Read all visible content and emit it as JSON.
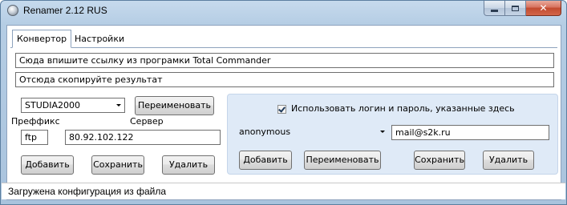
{
  "window": {
    "title": "Renamer 2.12 RUS",
    "close_glyph": "✕"
  },
  "tabs": [
    {
      "label": "Конвертор",
      "active": true
    },
    {
      "label": "Настройки",
      "active": false
    }
  ],
  "converter": {
    "input_placeholder": "Сюда впишите ссылку из програмки Total Commander",
    "output_placeholder": "Отсюда скопируйте результат"
  },
  "config": {
    "selected": "STUDIA2000",
    "rename_button": "Переименовать",
    "prefix_label": "Преффикс",
    "server_label": "Сервер",
    "prefix_value": "ftp",
    "server_value": "80.92.102.122",
    "add_button": "Добавить",
    "save_button": "Сохранить",
    "delete_button": "Удалить"
  },
  "login": {
    "use_credentials_label": "Использовать логин и пароль, указанные здесь",
    "use_credentials_checked": true,
    "login_selected": "anonymous",
    "password_value": "mail@s2k.ru",
    "add_button": "Добавить",
    "rename_button": "Переименовать",
    "save_button": "Сохранить",
    "delete_button": "Удалить"
  },
  "status": {
    "text": "Загружена конфигурация из файла"
  }
}
